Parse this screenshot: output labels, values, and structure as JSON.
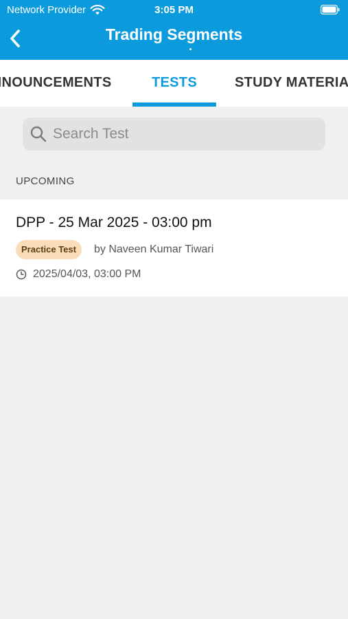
{
  "status_bar": {
    "carrier": "Network Provider",
    "time": "3:05 PM"
  },
  "header": {
    "title": "Trading Segments"
  },
  "tabs": [
    {
      "label": "ANNOUNCEMENTS",
      "visible_label": "NOUNCEMENTS",
      "active": false
    },
    {
      "label": "TESTS",
      "active": true
    },
    {
      "label": "STUDY MATERIA",
      "active": false
    }
  ],
  "search": {
    "placeholder": "Search Test",
    "value": ""
  },
  "section": {
    "label": "UPCOMING"
  },
  "tests": [
    {
      "title": "DPP - 25 Mar 2025 - 03:00 pm",
      "badge": "Practice Test",
      "author": "by Naveen Kumar Tiwari",
      "datetime": "2025/04/03, 03:00 PM"
    }
  ],
  "colors": {
    "primary": "#0b9bdd",
    "badge_bg": "#fbdcb8",
    "background": "#f0f0f0"
  },
  "icons": {
    "wifi": "wifi-icon",
    "battery": "battery-icon",
    "back": "chevron-left-icon",
    "search": "search-icon",
    "clock": "clock-icon"
  }
}
